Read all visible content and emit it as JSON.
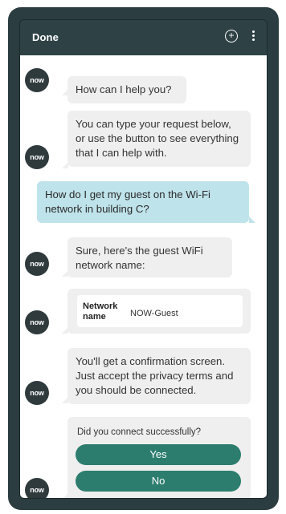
{
  "header": {
    "done_label": "Done",
    "add_icon": "plus-circle-icon",
    "menu_icon": "kebab-menu-icon"
  },
  "avatar_text": "now",
  "messages": [
    {
      "from": "bot",
      "text": "How can I help you?"
    },
    {
      "from": "bot",
      "text": "You can type your request below, or use the button to see everything that I can help with."
    },
    {
      "from": "user",
      "text": "How do I get my guest on the Wi-Fi network in building C?"
    },
    {
      "from": "bot",
      "text": "Sure, here's the guest WiFi network name:"
    },
    {
      "from": "bot",
      "card": {
        "label": "Network name",
        "value": "NOW-Guest"
      }
    },
    {
      "from": "bot",
      "text": "You'll get a confirmation screen. Just accept the privacy terms and you should be connected."
    }
  ],
  "question": {
    "text": "Did you connect successfully?",
    "yes_label": "Yes",
    "no_label": "No"
  },
  "colors": {
    "frame": "#2b3d40",
    "topbar": "#2e4245",
    "bot_bubble": "#efefef",
    "user_bubble": "#bfe3ea",
    "button": "#2c7d6e"
  }
}
